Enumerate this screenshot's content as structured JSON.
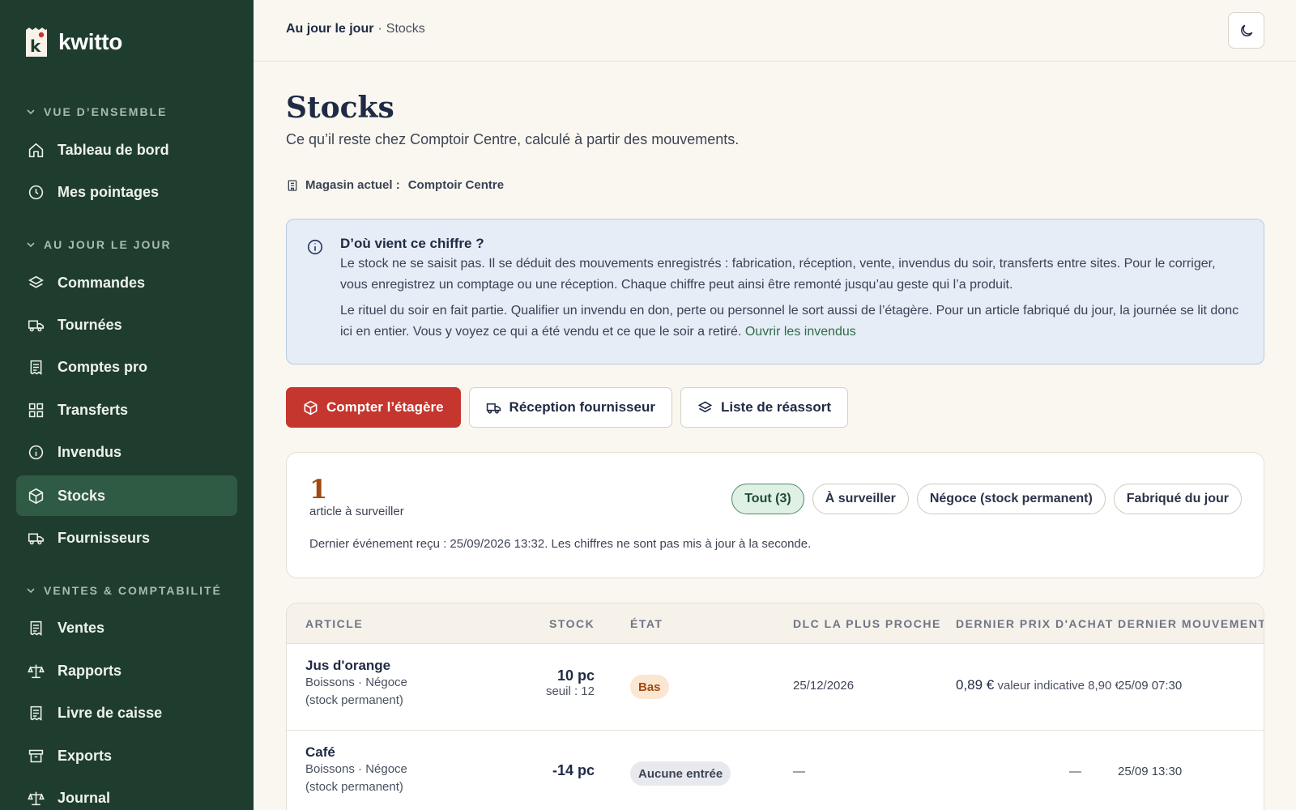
{
  "app": {
    "name": "kwitto",
    "logo_letter": "k"
  },
  "sidebar": {
    "sections": [
      {
        "label": "VUE D’ENSEMBLE"
      },
      {
        "label": "AU JOUR LE JOUR"
      },
      {
        "label": "VENTES & COMPTABILITÉ"
      }
    ],
    "items": [
      {
        "label": "Tableau de bord",
        "icon": "home-icon"
      },
      {
        "label": "Mes pointages",
        "icon": "clock-icon"
      },
      {
        "label": "Commandes",
        "icon": "layers-icon"
      },
      {
        "label": "Tournées",
        "icon": "truck-icon"
      },
      {
        "label": "Comptes pro",
        "icon": "receipt-icon"
      },
      {
        "label": "Transferts",
        "icon": "grid-icon"
      },
      {
        "label": "Invendus",
        "icon": "info-icon"
      },
      {
        "label": "Stocks",
        "icon": "box-icon",
        "active": true
      },
      {
        "label": "Fournisseurs",
        "icon": "truck-icon"
      },
      {
        "label": "Ventes",
        "icon": "receipt-icon"
      },
      {
        "label": "Rapports",
        "icon": "scale-icon"
      },
      {
        "label": "Livre de caisse",
        "icon": "receipt-icon"
      },
      {
        "label": "Exports",
        "icon": "archive-icon"
      },
      {
        "label": "Journal",
        "icon": "scale-icon"
      }
    ]
  },
  "topbar": {
    "breadcrumb_parent": "Au jour le jour",
    "breadcrumb_sep": "·",
    "breadcrumb_current": "Stocks",
    "theme_icon": "moon-icon"
  },
  "page": {
    "title": "Stocks",
    "subtitle": "Ce qu’il reste chez Comptoir Centre, calculé à partir des mouvements.",
    "store_label": "Magasin actuel :",
    "store_value": "Comptoir Centre"
  },
  "info": {
    "title": "D’où vient ce chiffre ?",
    "p1": "Le stock ne se saisit pas. Il se déduit des mouvements enregistrés : fabrication, réception, vente, invendus du soir, transferts entre sites. Pour le corriger, vous enregistrez un comptage ou une réception. Chaque chiffre peut ainsi être remonté jusqu’au geste qui l’a produit.",
    "p2": "Le rituel du soir en fait partie. Qualifier un invendu en don, perte ou personnel le sort aussi de l’étagère. Pour un article fabriqué du jour, la journée se lit donc ici en entier. Vous y voyez ce qui a été vendu et ce que le soir a retiré.",
    "link": "Ouvrir les invendus"
  },
  "actions": {
    "count": "Compter l’étagère",
    "reception": "Réception fournisseur",
    "restock": "Liste de réassort"
  },
  "summary": {
    "count": "1",
    "count_label": "article à surveiller",
    "note": "Dernier événement reçu : 25/09/2026 13:32. Les chiffres ne sont pas mis à jour à la seconde.",
    "filters": [
      "Tout (3)",
      "À surveiller",
      "Négoce (stock permanent)",
      "Fabriqué du jour"
    ]
  },
  "table": {
    "headers": [
      "ARTICLE",
      "STOCK",
      "ÉTAT",
      "DLC LA PLUS PROCHE",
      "DERNIER PRIX D'ACHAT",
      "DERNIER MOUVEMENT"
    ],
    "rows": [
      {
        "name": "Jus d'orange",
        "sub1": "Boissons · Négoce",
        "sub2": "(stock permanent)",
        "stock": "10 pc",
        "seuil": "seuil : 12",
        "state": "Bas",
        "dlc": "25/12/2026",
        "price": "0,89 €",
        "price_sub": "valeur indicative 8,90 €",
        "last": "25/09 07:30"
      },
      {
        "name": "Café",
        "sub1": "Boissons · Négoce",
        "sub2": "(stock permanent)",
        "stock": "-14 pc",
        "seuil": "",
        "state": "Aucune entrée",
        "dlc": "—",
        "price": "—",
        "price_sub": "",
        "last": "25/09 13:30"
      }
    ]
  },
  "colors": {
    "sidebar_bg": "#1f3d2f",
    "sidebar_active": "#2f5a44",
    "primary": "#c5362e",
    "accent_green": "#2f6b47",
    "warn": "#a04b12"
  }
}
